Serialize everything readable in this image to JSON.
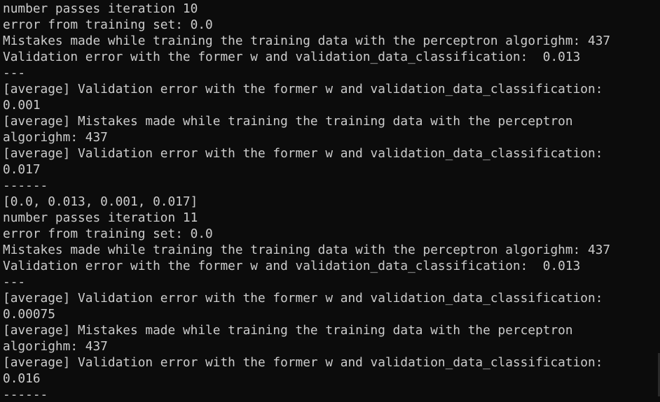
{
  "terminal": {
    "lines": [
      "number passes iteration 10",
      "error from training set: 0.0",
      "Mistakes made while training the training data with the perceptron algorighm: 437",
      "Validation error with the former w and validation_data_classification:  0.013",
      "---",
      "[average] Validation error with the former w and validation_data_classification:",
      "0.001",
      "[average] Mistakes made while training the training data with the perceptron",
      "algorighm: 437",
      "[average] Validation error with the former w and validation_data_classification:",
      "0.017",
      "------",
      "[0.0, 0.013, 0.001, 0.017]",
      "number passes iteration 11",
      "error from training set: 0.0",
      "Mistakes made while training the training data with the perceptron algorighm: 437",
      "Validation error with the former w and validation_data_classification:  0.013",
      "---",
      "[average] Validation error with the former w and validation_data_classification:",
      "0.00075",
      "[average] Mistakes made while training the training data with the perceptron",
      "algorighm: 437",
      "[average] Validation error with the former w and validation_data_classification:",
      "0.016",
      "------"
    ]
  },
  "colors": {
    "background": "#0c0c0c",
    "text": "#cccccc"
  }
}
